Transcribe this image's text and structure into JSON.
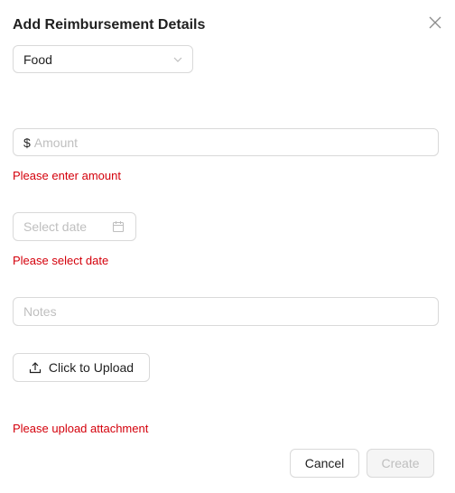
{
  "modal": {
    "title": "Add Reimbursement Details"
  },
  "category_select": {
    "value": "Food"
  },
  "amount": {
    "prefix": "$",
    "placeholder": "Amount",
    "error": "Please enter amount"
  },
  "date": {
    "placeholder": "Select date",
    "error": "Please select date"
  },
  "notes": {
    "placeholder": "Notes"
  },
  "upload": {
    "label": "Click to Upload",
    "error": "Please upload attachment"
  },
  "footer": {
    "cancel_label": "Cancel",
    "create_label": "Create"
  },
  "colors": {
    "error": "#d4000b",
    "border": "#d9d9d9",
    "placeholder": "#bfbfbf"
  },
  "icons": {
    "close": "close-icon",
    "chevron": "chevron-down-icon",
    "calendar": "calendar-icon",
    "upload": "upload-icon"
  }
}
